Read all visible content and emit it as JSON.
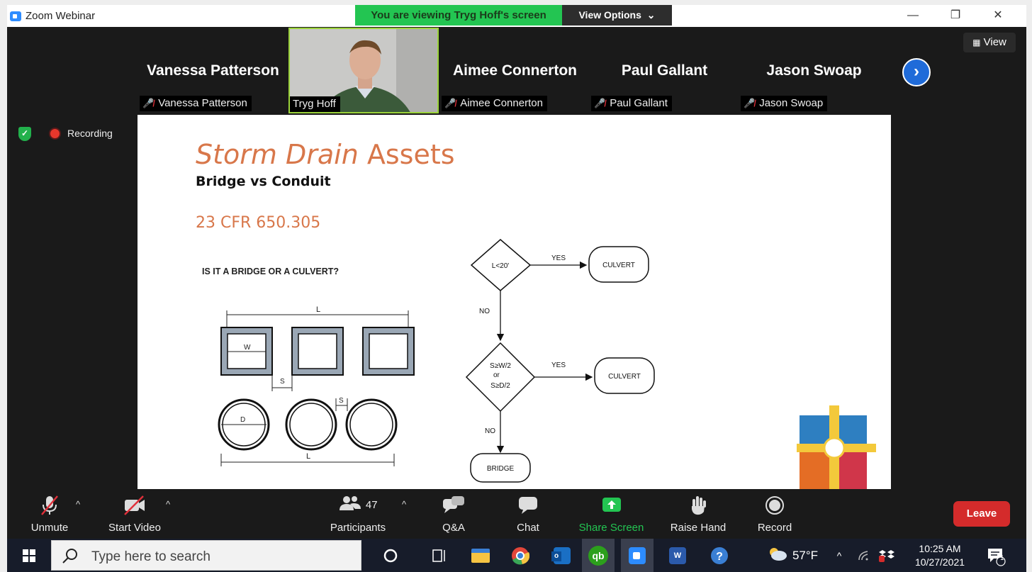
{
  "window": {
    "title": "Zoom Webinar",
    "screen_banner": "You are viewing Tryg Hoff's screen",
    "view_options": "View Options",
    "view_options_caret": "⌄",
    "minimize": "—",
    "restore": "❐",
    "close": "✕"
  },
  "gallery": {
    "view_label": "View",
    "next_arrow": "›",
    "tiles": [
      {
        "name_big": "Vanessa Patterson",
        "label": "Vanessa Patterson",
        "muted": true
      },
      {
        "name_big": "",
        "label": "Tryg Hoff",
        "muted": false
      },
      {
        "name_big": "Aimee Connerton",
        "label": "Aimee Connerton",
        "muted": true
      },
      {
        "name_big": "Paul Gallant",
        "label": "Paul Gallant",
        "muted": true
      },
      {
        "name_big": "Jason Swoap",
        "label": "Jason Swoap",
        "muted": true
      }
    ]
  },
  "status": {
    "recording": "Recording",
    "shield_check": "✓"
  },
  "slide": {
    "title_italic": "Storm Drain",
    "title_rest": " Assets",
    "subtitle": "Bridge vs Conduit",
    "cfr": "23 CFR 650.305",
    "question": "IS IT A BRIDGE OR A CULVERT?",
    "diagram": {
      "label_L": "L",
      "label_W": "W",
      "label_S": "S",
      "label_D": "D"
    },
    "flow": {
      "q1": "L<20'",
      "yes": "YES",
      "no": "NO",
      "culvert": "CULVERT",
      "q2_line1": "S≥W/2",
      "q2_line2": "or",
      "q2_line3": "S≥D/2",
      "bridge": "BRIDGE"
    }
  },
  "toolbar": {
    "unmute": "Unmute",
    "start_video": "Start Video",
    "participants": "Participants",
    "participants_count": "47",
    "qa": "Q&A",
    "chat": "Chat",
    "share_screen": "Share Screen",
    "raise_hand": "Raise Hand",
    "record": "Record",
    "leave": "Leave",
    "caret": "^"
  },
  "taskbar": {
    "search_placeholder": "Type here to search",
    "weather": "57°F",
    "time": "10:25 AM",
    "date": "10/27/2021",
    "notification_count": "1",
    "tray_caret": "^"
  },
  "colors": {
    "accent_green": "#23c552",
    "slide_title": "#d8774a",
    "leave_red": "#d42b2b",
    "zoom_blue": "#2d8cff"
  }
}
